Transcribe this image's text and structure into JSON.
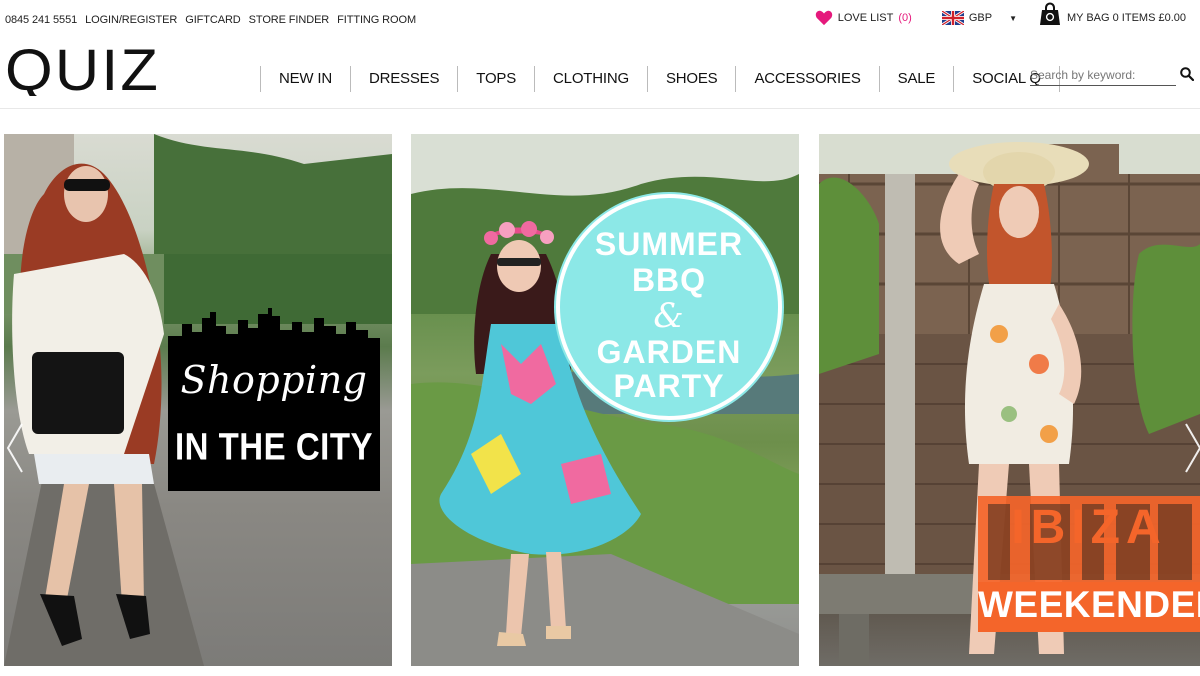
{
  "topbar": {
    "phone": "0845 241 5551",
    "links": [
      "LOGIN/REGISTER",
      "GIFTCARD",
      "STORE FINDER",
      "FITTING ROOM"
    ],
    "love_list": {
      "label": "LOVE LIST",
      "count": "(0)"
    },
    "currency": "GBP",
    "bag": "MY BAG 0 ITEMS £0.00"
  },
  "header": {
    "logo_text": "QUIZ",
    "nav": [
      "NEW IN",
      "DRESSES",
      "TOPS",
      "CLOTHING",
      "SHOES",
      "ACCESSORIES",
      "SALE",
      "SOCIAL Q"
    ],
    "search_placeholder": "Search by keyword:"
  },
  "carousel": {
    "panels": [
      {
        "title_script": "Shopping",
        "title_sub": "IN THE CITY"
      },
      {
        "line1": "SUMMER",
        "line2": "BBQ",
        "amp": "&",
        "line3": "GARDEN",
        "line4": "PARTY"
      },
      {
        "title_big": "IBIZA",
        "title_sub": "WEEKENDER"
      }
    ]
  },
  "colors": {
    "accent_pink": "#e5197c",
    "bbq_teal": "#8ce8e7",
    "ibiza_orange": "#f4652a"
  },
  "icons": [
    "heart-icon",
    "uk-flag-icon",
    "chevron-down-icon",
    "shopping-bag-icon",
    "search-icon",
    "chevron-left-icon",
    "chevron-right-icon"
  ]
}
